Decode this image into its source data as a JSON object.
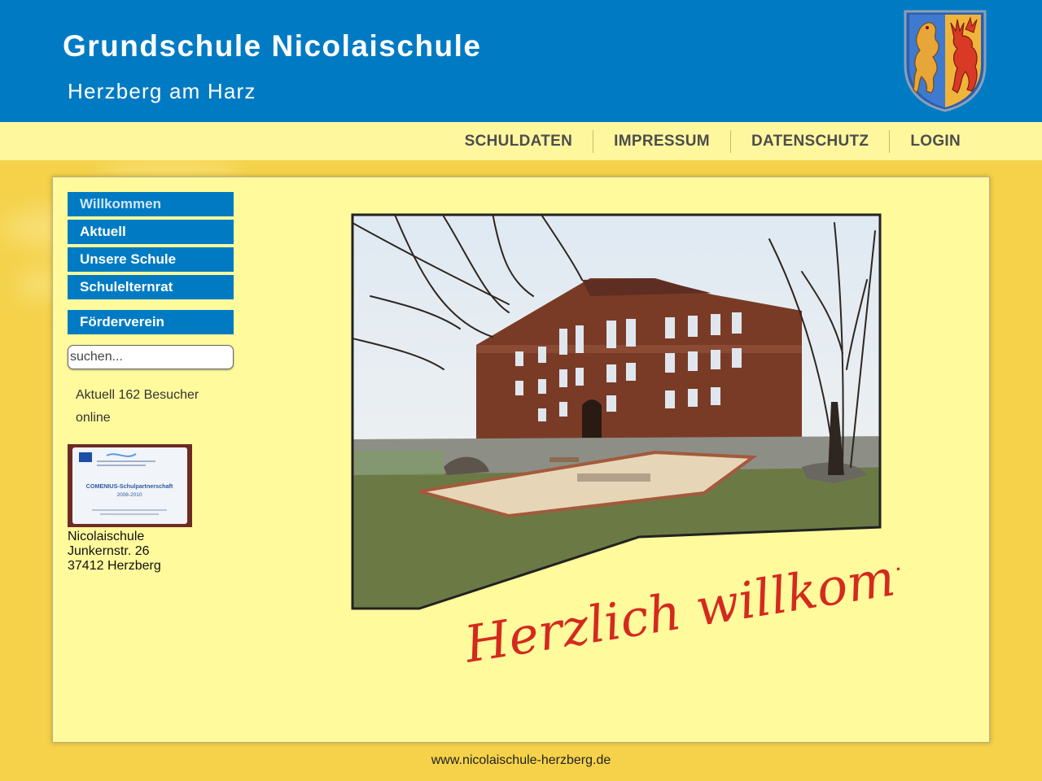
{
  "header": {
    "title": "Grundschule Nicolaischule",
    "subtitle": "Herzberg am Harz",
    "logo_icon": "coat-of-arms-icon"
  },
  "nav": {
    "items": [
      {
        "label": "SCHULDATEN"
      },
      {
        "label": "IMPRESSUM"
      },
      {
        "label": "DATENSCHUTZ"
      },
      {
        "label": "LOGIN"
      }
    ]
  },
  "sidebar": {
    "menu": [
      {
        "label": "Willkommen"
      },
      {
        "label": "Aktuell"
      },
      {
        "label": "Unsere Schule"
      },
      {
        "label": "Schulelternrat"
      },
      {
        "label": "Förderverein"
      }
    ],
    "search": {
      "placeholder": "suchen..."
    },
    "visitors_text": "Aktuell 162 Besucher online",
    "badge": {
      "title": "COMENIUS-Schulpartnerschaft",
      "years": "2008-2010"
    },
    "address": {
      "name": "Nicolaischule",
      "street": "Junkernstr. 26",
      "city": "37412 Herzberg"
    }
  },
  "main": {
    "welcome_text": "Herzlich willkommen"
  },
  "footer": {
    "url": "www.nicolaischule-herzberg.de"
  },
  "colors": {
    "header_blue": "#007bc3",
    "nav_bg": "#fff79e",
    "page_bg": "#f5d24a",
    "panel_bg": "#fffa9c",
    "welcome_red": "#d42a1e"
  }
}
